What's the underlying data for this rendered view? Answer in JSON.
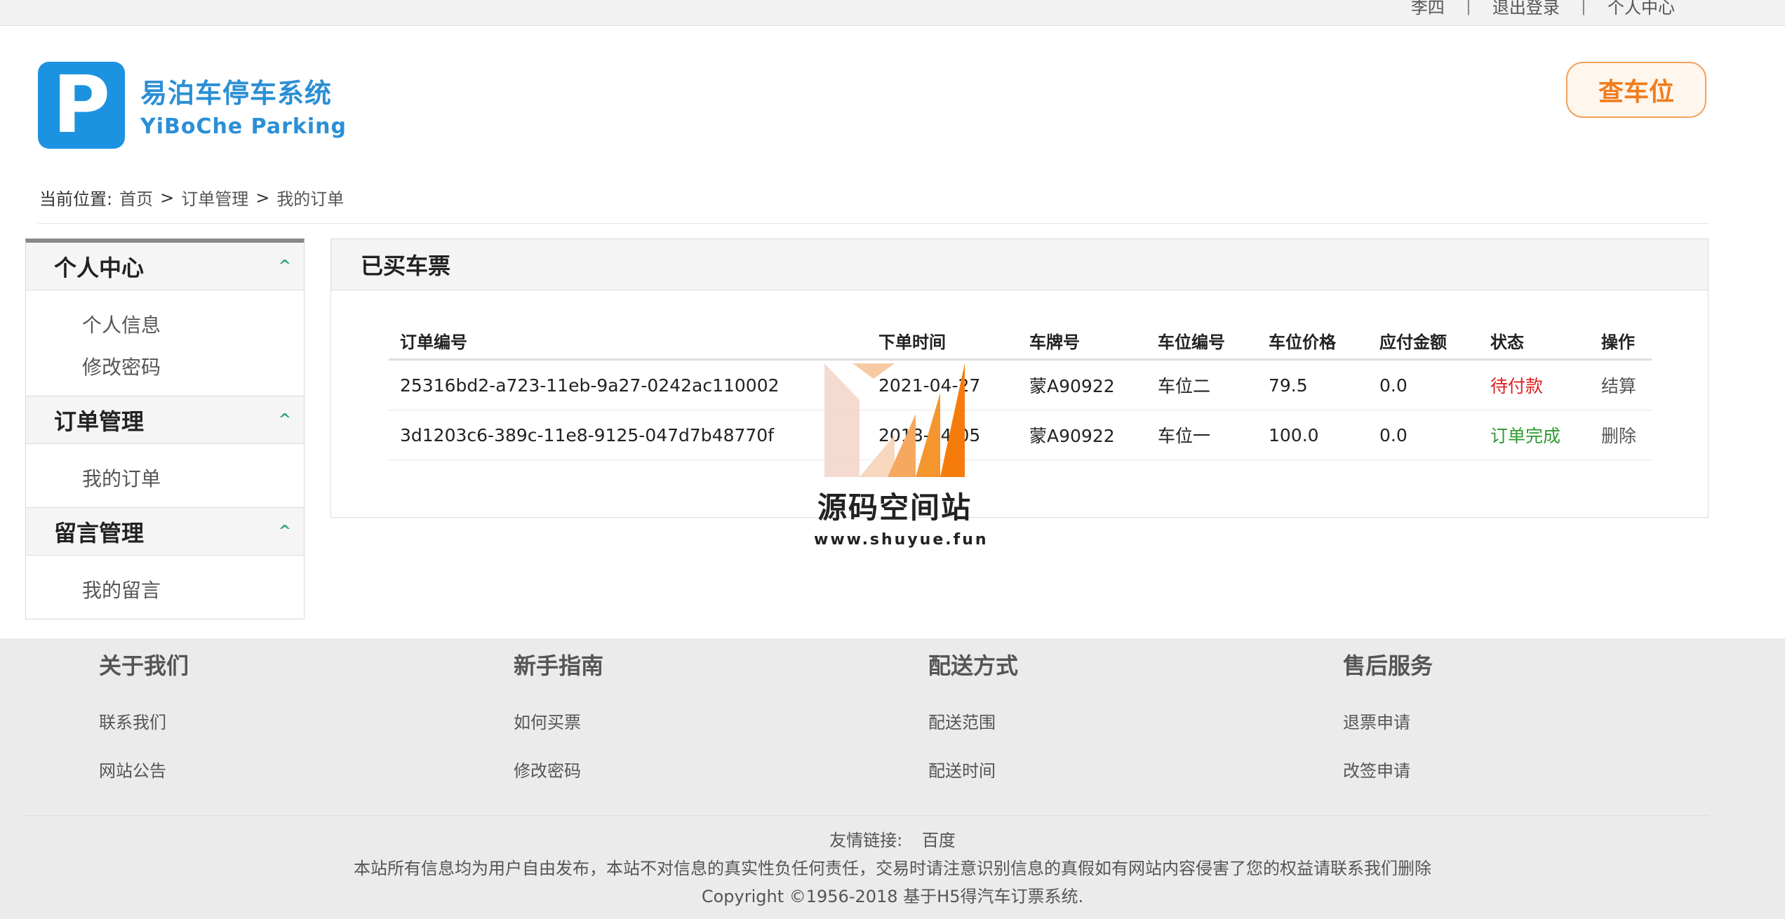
{
  "topbar": {
    "user": "李四",
    "logout": "退出登录",
    "profile": "个人中心",
    "sep": "|"
  },
  "logo": {
    "letter": "P",
    "cn": "易泊车停车系统",
    "en": "YiBoChe  Parking"
  },
  "find_button": "查车位",
  "breadcrumb": {
    "label": "当前位置:",
    "items": [
      "首页",
      "订单管理",
      "我的订单"
    ],
    "sep": ">"
  },
  "sidebar": {
    "sections": [
      {
        "title": "个人中心",
        "items": [
          "个人信息",
          "修改密码"
        ]
      },
      {
        "title": "订单管理",
        "items": [
          "我的订单"
        ]
      },
      {
        "title": "留言管理",
        "items": [
          "我的留言"
        ]
      }
    ],
    "caret": "^"
  },
  "panel": {
    "title": "已买车票",
    "columns": [
      "订单编号",
      "下单时间",
      "车牌号",
      "车位编号",
      "车位价格",
      "应付金额",
      "状态",
      "操作"
    ],
    "rows": [
      {
        "id": "25316bd2-a723-11eb-9a27-0242ac110002",
        "time": "2021-04-27",
        "plate": "蒙A90922",
        "spot": "车位二",
        "price": "79.5",
        "due": "0.0",
        "status": "待付款",
        "action": "结算"
      },
      {
        "id": "3d1203c6-389c-11e8-9125-047d7b48770f",
        "time": "2018-04-05",
        "plate": "蒙A90922",
        "spot": "车位一",
        "price": "100.0",
        "due": "0.0",
        "status": "订单完成",
        "action": "删除"
      }
    ]
  },
  "watermark": {
    "cn": "源码空间站",
    "url": "www.shuyue.fun"
  },
  "footer": {
    "columns": [
      {
        "title": "关于我们",
        "links": [
          "联系我们",
          "网站公告"
        ]
      },
      {
        "title": "新手指南",
        "links": [
          "如何买票",
          "修改密码"
        ]
      },
      {
        "title": "配送方式",
        "links": [
          "配送范围",
          "配送时间"
        ]
      },
      {
        "title": "售后服务",
        "links": [
          "退票申请",
          "改签申请"
        ]
      }
    ],
    "friend_label": "友情链接:",
    "friend_link": "百度",
    "disclaimer": "本站所有信息均为用户自由发布，本站不对信息的真实性负任何责任，交易时请注意识别信息的真假如有网站内容侵害了您的权益请联系我们删除",
    "copyright": "Copyright ©1956-2018 基于H5得汽车订票系统."
  },
  "colors": {
    "brand_blue": "#1c93e0",
    "accent_orange": "#f07d1e",
    "status_pending": "#e02020",
    "status_done": "#2e9a2e"
  }
}
